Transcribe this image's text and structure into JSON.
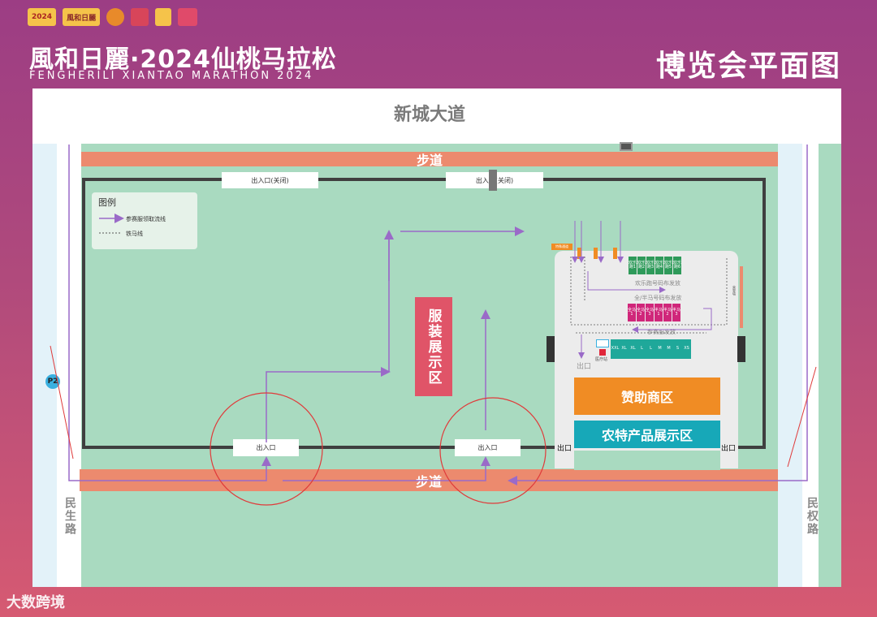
{
  "header": {
    "logos": [
      "2024",
      "風和日麗",
      "logo",
      "logo",
      "logo",
      "logo"
    ],
    "title": "風和日麗·2024仙桃马拉松",
    "subtitle": "FENGHERILI XIANTAO MARATHON 2024",
    "map_title": "博览会平面图"
  },
  "roads": {
    "top": "新城大道",
    "left": "民生路",
    "right": "民权路"
  },
  "sidewalk": {
    "top": "步道",
    "bottom": "步道"
  },
  "gates": {
    "top_left": "出入口(关闭)",
    "top_right": "出入口(关闭)",
    "bottom_left": "出入口",
    "bottom_right": "出入口"
  },
  "legend": {
    "title": "图例",
    "items": [
      {
        "label": "参赛服领取流线",
        "style": "arrow"
      },
      {
        "label": "铁马线",
        "style": "dotted"
      }
    ]
  },
  "zones": {
    "clothing_display": "服装展示区",
    "sponsor": "赞助商区",
    "agri_products": "农特产品展示区"
  },
  "pavilion": {
    "top_tag": "特殊通道",
    "fun_run_label": "欢乐跑号码布发放",
    "fun_run_booths": [
      "欢乐跑1",
      "欢乐跑2",
      "欢乐跑3",
      "欢乐跑4",
      "欢乐跑5",
      "欢乐跑6"
    ],
    "full_half_label": "全/半马号码布发放",
    "full_half_booths": [
      "全马1",
      "全马2",
      "全马3",
      "半马1",
      "半马2",
      "半马3"
    ],
    "clothing_label": "参赛服发放",
    "sizes": [
      "XXL",
      "XL",
      "XL",
      "L",
      "L",
      "M",
      "M",
      "S",
      "XS"
    ],
    "medical_label": "医疗站",
    "inner_exit": "出口",
    "left_exit": "出口",
    "right_exit": "出口",
    "side_label": "荣誉墙"
  },
  "markers": {
    "parking": "P2"
  },
  "watermark": "大数跨境",
  "colors": {
    "background_top": "#9c3d84",
    "background_bottom": "#d65a72",
    "grass": "#a9dac0",
    "sidewalk": "#ec8a6e",
    "clothing_zone": "#e05468",
    "sponsor": "#f08c24",
    "agri": "#17a8b8",
    "fun_run_booth": "#2e9a5a",
    "full_half_booth": "#d0267a",
    "size_booth": "#1fa89a",
    "flow_arrow": "#9a6ac8",
    "highlight_circle": "#e03a3a"
  }
}
